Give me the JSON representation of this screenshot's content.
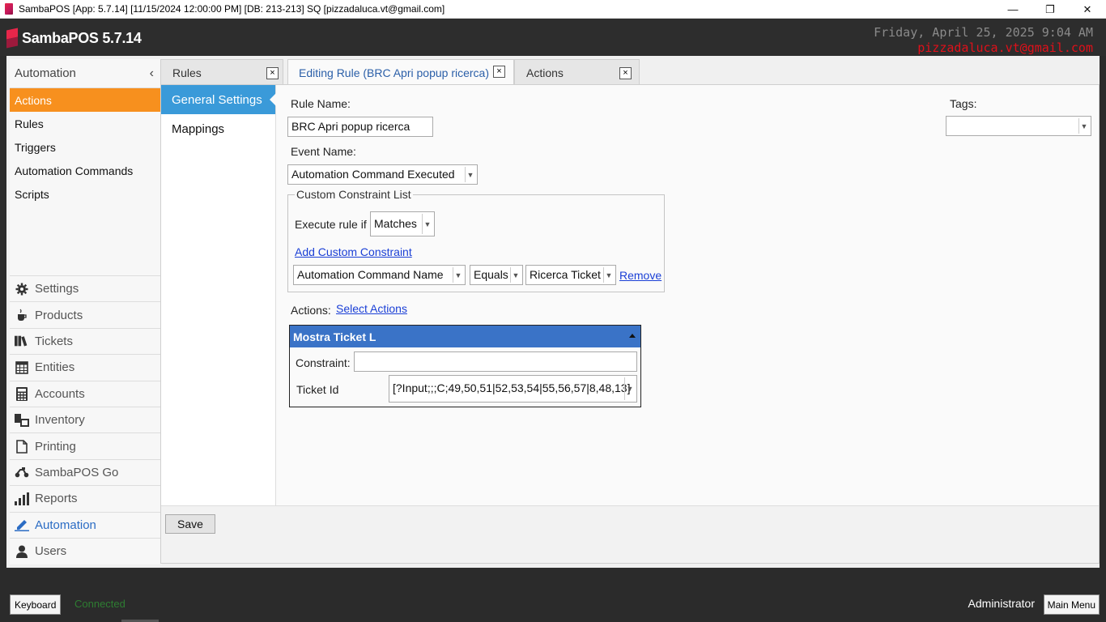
{
  "window": {
    "title": "SambaPOS [App: 5.7.14] [11/15/2024 12:00:00 PM] [DB: 213-213] SQ [pizzadaluca.vt@gmail.com]",
    "minimize": "—",
    "restore": "❐",
    "close": "✕"
  },
  "header": {
    "logo": "SambaPOS 5.7.14",
    "datetime": "Friday, April 25, 2025 9:04 AM",
    "email": "pizzadaluca.vt@gmail.com"
  },
  "sidebar": {
    "title": "Automation",
    "collapse": "‹",
    "items": [
      {
        "label": "Actions",
        "active": true
      },
      {
        "label": "Rules"
      },
      {
        "label": "Triggers"
      },
      {
        "label": "Automation Commands"
      },
      {
        "label": "Scripts"
      }
    ],
    "sections": [
      {
        "label": "Settings",
        "icon": "gear-icon"
      },
      {
        "label": "Products",
        "icon": "coffee-icon"
      },
      {
        "label": "Tickets",
        "icon": "books-icon"
      },
      {
        "label": "Entities",
        "icon": "table-icon"
      },
      {
        "label": "Accounts",
        "icon": "calculator-icon"
      },
      {
        "label": "Inventory",
        "icon": "inventory-icon"
      },
      {
        "label": "Printing",
        "icon": "document-icon"
      },
      {
        "label": "SambaPOS Go",
        "icon": "scooter-icon"
      },
      {
        "label": "Reports",
        "icon": "bar-chart-icon"
      },
      {
        "label": "Automation",
        "icon": "pencil-icon",
        "active": true
      },
      {
        "label": "Users",
        "icon": "user-icon"
      }
    ]
  },
  "tabs": [
    {
      "label": "Rules",
      "close": "×"
    },
    {
      "label": "Editing Rule (BRC Apri popup ricerca)",
      "close": "×",
      "active": true
    },
    {
      "label": "Actions",
      "close": "×"
    }
  ],
  "subnav": {
    "items": [
      {
        "label": "General Settings",
        "active": true
      },
      {
        "label": "Mappings"
      }
    ]
  },
  "form": {
    "rule_name_label": "Rule Name:",
    "rule_name_value": "BRC Apri popup ricerca",
    "tags_label": "Tags:",
    "tags_value": "",
    "event_name_label": "Event Name:",
    "event_name_value": "Automation Command Executed",
    "constraint_list_title": "Custom Constraint List",
    "execute_rule_if_label": "Execute rule if",
    "execute_rule_if_value": "Matches",
    "add_constraint_link": "Add Custom Constraint",
    "constraint": {
      "field": "Automation Command Name",
      "operator": "Equals",
      "value": "Ricerca Ticket",
      "remove": "Remove"
    },
    "actions_label": "Actions:",
    "select_actions_link": "Select Actions",
    "action_card": {
      "name": "Mostra Ticket L",
      "constraint_label": "Constraint:",
      "constraint_value": "",
      "ticket_id_label": "Ticket Id",
      "ticket_id_value": "[?Input;;;C;49,50,51|52,53,54|55,56,57|8,48,13]"
    },
    "save": "Save"
  },
  "statusbar": {
    "keyboard": "Keyboard",
    "connection": "Connected",
    "user": "Administrator",
    "main_menu": "Main Menu"
  }
}
